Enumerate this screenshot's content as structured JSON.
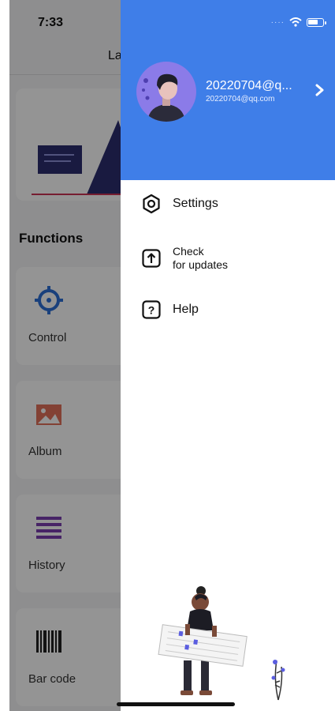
{
  "background_app": {
    "time": "7:33",
    "title_partial": "La",
    "section_title": "Functions",
    "cards": [
      {
        "label": "Control",
        "icon": "crosshair-icon"
      },
      {
        "label": "Album",
        "icon": "image-icon"
      },
      {
        "label": "History",
        "icon": "list-icon"
      },
      {
        "label": "Bar code",
        "icon": "barcode-icon"
      }
    ]
  },
  "drawer": {
    "header_color": "#3f7ee8",
    "user": {
      "name": "20220704@q...",
      "email": "20220704@qq.com"
    },
    "menu": [
      {
        "label": "Settings",
        "icon": "settings-icon"
      },
      {
        "label_line1": "Check",
        "label_line2": "for updates",
        "icon": "upload-icon"
      },
      {
        "label": "Help",
        "icon": "help-icon"
      }
    ]
  }
}
